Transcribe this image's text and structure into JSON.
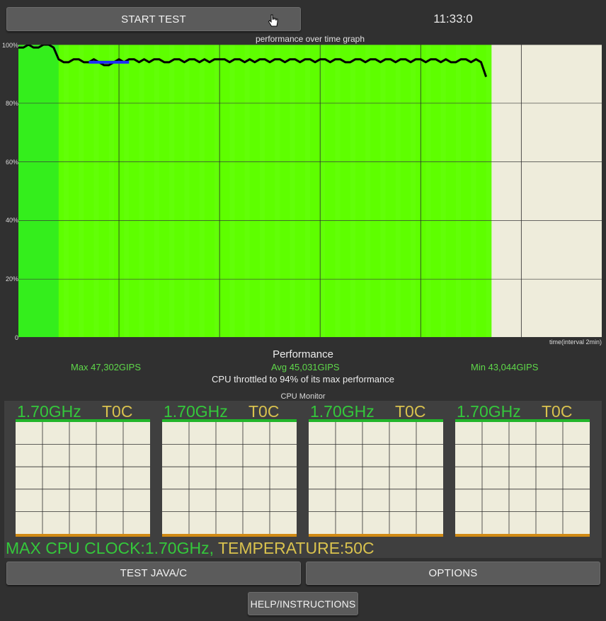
{
  "header": {
    "start_label": "START TEST",
    "time": "11:33:0"
  },
  "graph": {
    "title": "performance over time graph",
    "x_label": "time(interval 2min)",
    "y_ticks": [
      "100%",
      "80%",
      "60%",
      "40%",
      "20%",
      "0"
    ],
    "colors": {
      "background": "#eeecdb",
      "fill": "#5eff00",
      "fill_first": "#34ee1c",
      "line": "#000000",
      "highlight": "#1e2dff"
    }
  },
  "performance": {
    "title": "Performance",
    "max": "Max 47,302GIPS",
    "avg": "Avg 45,031GIPS",
    "min": "Min 43,044GIPS",
    "throttle": "CPU throttled to 94% of its max performance"
  },
  "cpu_monitor": {
    "title": "CPU Monitor",
    "cores": [
      {
        "freq": "1.70GHz",
        "temp": "T0C"
      },
      {
        "freq": "1.70GHz",
        "temp": "T0C"
      },
      {
        "freq": "1.70GHz",
        "temp": "T0C"
      },
      {
        "freq": "1.70GHz",
        "temp": "T0C"
      }
    ],
    "max_clock": "MAX CPU CLOCK:1.70GHz,",
    "temperature": "TEMPERATURE:50C"
  },
  "buttons": {
    "test_java": "TEST JAVA/C",
    "options": "OPTIONS",
    "help": "HELP/INSTRUCTIONS"
  },
  "chart_data": {
    "type": "area",
    "title": "performance over time graph",
    "xlabel": "time(interval 2min)",
    "ylabel": "",
    "ylim": [
      0,
      100
    ],
    "y_ticks": [
      "100%",
      "80%",
      "60%",
      "40%",
      "20%",
      "0"
    ],
    "x": [
      0,
      0.25,
      0.5,
      0.75,
      1,
      1.25,
      1.5,
      1.75,
      2,
      2.25,
      2.5,
      2.75,
      3,
      3.25,
      3.5,
      3.75,
      4,
      4.25,
      4.5,
      4.75,
      5,
      5.25,
      5.5,
      5.75,
      6,
      6.25,
      6.5,
      6.75,
      7,
      7.25,
      7.5,
      7.75,
      8,
      8.25,
      8.5,
      8.75,
      9,
      9.25,
      9.5,
      9.75,
      10,
      10.25,
      10.5,
      10.75,
      11,
      11.25,
      11.5,
      11.75,
      12,
      12.25,
      12.5,
      12.75,
      13,
      13.25,
      13.5,
      13.75,
      14,
      14.25,
      14.5,
      14.75,
      15,
      15.25,
      15.5,
      15.75,
      16,
      16.25,
      16.5,
      16.75,
      17,
      17.25,
      17.5,
      17.75,
      18,
      18.25,
      18.5,
      18.75,
      19,
      19.25,
      19.5,
      19.75,
      20,
      20.25,
      20.5,
      20.75,
      21,
      21.25,
      21.5,
      21.75,
      22,
      22.25,
      22.5,
      22.75,
      23,
      23.25
    ],
    "series": [
      {
        "values": [
          99,
          99,
          100,
          99,
          99,
          100,
          100,
          99,
          95,
          94,
          94,
          95,
          95,
          94,
          94,
          95,
          94,
          93,
          93,
          94,
          95,
          94,
          95,
          95,
          94,
          95,
          94,
          95,
          95,
          94,
          94,
          95,
          95,
          94,
          95,
          95,
          94,
          95,
          94,
          95,
          95,
          95,
          94,
          95,
          95,
          94,
          95,
          94,
          95,
          95,
          94,
          95,
          95,
          94,
          95,
          95,
          94,
          95,
          95,
          94,
          95,
          95,
          94,
          95,
          95,
          94,
          94,
          95,
          95,
          94,
          95,
          95,
          94,
          95,
          95,
          94,
          95,
          95,
          94,
          95,
          95,
          94,
          95,
          95,
          94,
          95,
          94,
          94,
          95,
          95,
          94,
          95,
          94,
          89
        ]
      }
    ],
    "highlight": {
      "x_start": 3.5,
      "x_end": 5.5,
      "value": 94
    }
  }
}
